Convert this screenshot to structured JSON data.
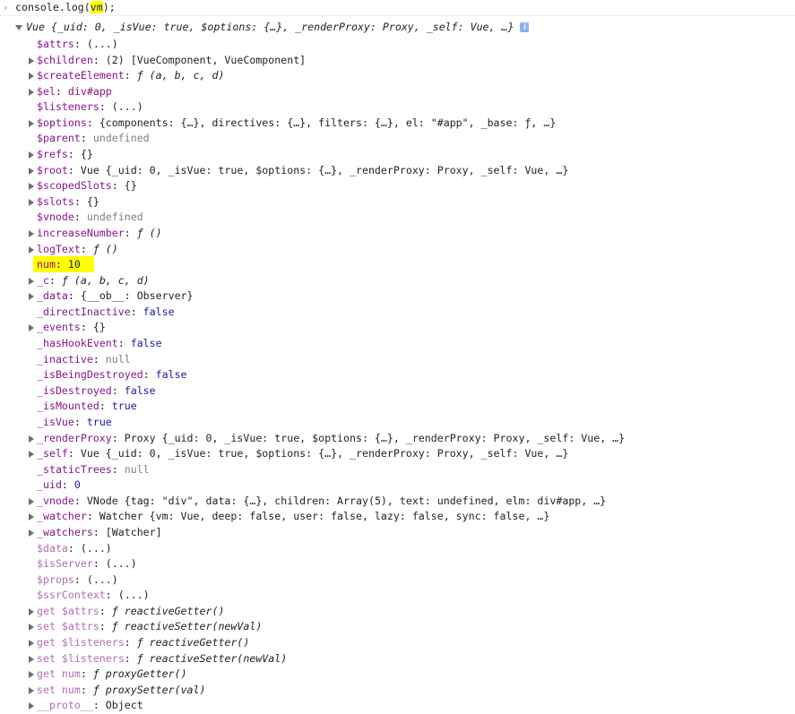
{
  "console_input": {
    "prompt_glyph": "›",
    "command_before": "console.log(",
    "command_arg": "vm",
    "command_after": ");"
  },
  "root_object": {
    "type": "Vue",
    "preview": " {_uid: 0, _isVue: true, $options: {…}, _renderProxy: Proxy, _self: Vue, …}",
    "info_glyph": "i"
  },
  "props": [
    {
      "key": "$attrs",
      "sep": ": ",
      "val": "(...)",
      "cls": "",
      "exp": false
    },
    {
      "key": "$children",
      "sep": ": ",
      "val": "(2) [VueComponent, VueComponent]",
      "cls": "",
      "exp": true
    },
    {
      "key": "$createElement",
      "sep": ": ",
      "val": "ƒ (a, b, c, d)",
      "cls": "it",
      "exp": true
    },
    {
      "key": "$el",
      "sep": ": ",
      "val": "div#app",
      "cls": "v-el",
      "exp": true
    },
    {
      "key": "$listeners",
      "sep": ": ",
      "val": "(...)",
      "cls": "",
      "exp": false
    },
    {
      "key": "$options",
      "sep": ": ",
      "val": "{components: {…}, directives: {…}, filters: {…}, el: \"#app\", _base: ƒ, …}",
      "cls": "",
      "exp": true
    },
    {
      "key": "$parent",
      "sep": ": ",
      "val": "undefined",
      "cls": "v-null",
      "exp": false
    },
    {
      "key": "$refs",
      "sep": ": ",
      "val": "{}",
      "cls": "",
      "exp": true
    },
    {
      "key": "$root",
      "sep": ": ",
      "val": "Vue {_uid: 0, _isVue: true, $options: {…}, _renderProxy: Proxy, _self: Vue, …}",
      "cls": "",
      "exp": true
    },
    {
      "key": "$scopedSlots",
      "sep": ": ",
      "val": "{}",
      "cls": "",
      "exp": true
    },
    {
      "key": "$slots",
      "sep": ": ",
      "val": "{}",
      "cls": "",
      "exp": true
    },
    {
      "key": "$vnode",
      "sep": ": ",
      "val": "undefined",
      "cls": "v-null",
      "exp": false
    },
    {
      "key": "increaseNumber",
      "sep": ": ",
      "val": "ƒ ()",
      "cls": "it",
      "exp": true
    },
    {
      "key": "logText",
      "sep": ": ",
      "val": "ƒ ()",
      "cls": "it",
      "exp": true
    },
    {
      "key": "num",
      "sep": ": ",
      "val": "10",
      "cls": "",
      "exp": false
    },
    {
      "key": "_c",
      "sep": ": ",
      "val": "ƒ (a, b, c, d)",
      "cls": "it",
      "exp": true
    },
    {
      "key": "_data",
      "sep": ": ",
      "val": "{__ob__: Observer}",
      "cls": "",
      "exp": true
    },
    {
      "key": "_directInactive",
      "sep": ": ",
      "val": "false",
      "cls": "v-blue",
      "exp": false
    },
    {
      "key": "_events",
      "sep": ": ",
      "val": "{}",
      "cls": "",
      "exp": true
    },
    {
      "key": "_hasHookEvent",
      "sep": ": ",
      "val": "false",
      "cls": "v-blue",
      "exp": false
    },
    {
      "key": "_inactive",
      "sep": ": ",
      "val": "null",
      "cls": "v-null",
      "exp": false
    },
    {
      "key": "_isBeingDestroyed",
      "sep": ": ",
      "val": "false",
      "cls": "v-blue",
      "exp": false
    },
    {
      "key": "_isDestroyed",
      "sep": ": ",
      "val": "false",
      "cls": "v-blue",
      "exp": false
    },
    {
      "key": "_isMounted",
      "sep": ": ",
      "val": "true",
      "cls": "v-blue",
      "exp": false
    },
    {
      "key": "_isVue",
      "sep": ": ",
      "val": "true",
      "cls": "v-blue",
      "exp": false
    },
    {
      "key": "_renderProxy",
      "sep": ": ",
      "val": "Proxy {_uid: 0, _isVue: true, $options: {…}, _renderProxy: Proxy, _self: Vue, …}",
      "cls": "",
      "exp": true
    },
    {
      "key": "_self",
      "sep": ": ",
      "val": "Vue {_uid: 0, _isVue: true, $options: {…}, _renderProxy: Proxy, _self: Vue, …}",
      "cls": "",
      "exp": true
    },
    {
      "key": "_staticTrees",
      "sep": ": ",
      "val": "null",
      "cls": "v-null",
      "exp": false
    },
    {
      "key": "_uid",
      "sep": ": ",
      "val": "0",
      "cls": "v-blue",
      "exp": false
    },
    {
      "key": "_vnode",
      "sep": ": ",
      "val": "VNode {tag: \"div\", data: {…}, children: Array(5), text: undefined, elm: div#app, …}",
      "cls": "",
      "exp": true
    },
    {
      "key": "_watcher",
      "sep": ": ",
      "val": "Watcher {vm: Vue, deep: false, user: false, lazy: false, sync: false, …}",
      "cls": "",
      "exp": true
    },
    {
      "key": "_watchers",
      "sep": ": ",
      "val": "[Watcher]",
      "cls": "",
      "exp": true
    },
    {
      "key": "$data",
      "sep": ": ",
      "val": "(...)",
      "cls": "",
      "exp": false,
      "dim": true
    },
    {
      "key": "$isServer",
      "sep": ": ",
      "val": "(...)",
      "cls": "",
      "exp": false,
      "dim": true
    },
    {
      "key": "$props",
      "sep": ": ",
      "val": "(...)",
      "cls": "",
      "exp": false,
      "dim": true
    },
    {
      "key": "$ssrContext",
      "sep": ": ",
      "val": "(...)",
      "cls": "",
      "exp": false,
      "dim": true
    },
    {
      "key": "get $attrs",
      "sep": ": ",
      "val": "ƒ reactiveGetter()",
      "cls": "it",
      "exp": true,
      "dim": true
    },
    {
      "key": "set $attrs",
      "sep": ": ",
      "val": "ƒ reactiveSetter(newVal)",
      "cls": "it",
      "exp": true,
      "dim": true
    },
    {
      "key": "get $listeners",
      "sep": ": ",
      "val": "ƒ reactiveGetter()",
      "cls": "it",
      "exp": true,
      "dim": true
    },
    {
      "key": "set $listeners",
      "sep": ": ",
      "val": "ƒ reactiveSetter(newVal)",
      "cls": "it",
      "exp": true,
      "dim": true
    },
    {
      "key": "get num",
      "sep": ": ",
      "val": "ƒ proxyGetter()",
      "cls": "it",
      "exp": true,
      "dim": true
    },
    {
      "key": "set num",
      "sep": ": ",
      "val": "ƒ proxySetter(val)",
      "cls": "it",
      "exp": true,
      "dim": true
    },
    {
      "key": "__proto__",
      "sep": ": ",
      "val": "Object",
      "cls": "",
      "exp": true,
      "dim": true
    }
  ],
  "highlight_color": "#ffff00",
  "key_color": "#881391"
}
